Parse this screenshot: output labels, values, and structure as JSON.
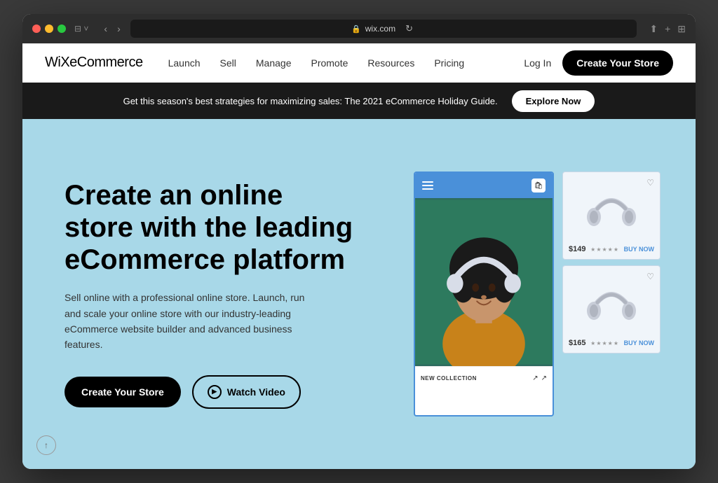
{
  "browser": {
    "address": "wix.com",
    "back_label": "‹",
    "forward_label": "›",
    "refresh_label": "↻",
    "share_label": "⬆",
    "new_tab_label": "+",
    "grid_label": "⊞"
  },
  "navbar": {
    "logo": "WiX",
    "logo_suffix": "eCommerce",
    "links": [
      {
        "label": "Launch"
      },
      {
        "label": "Sell"
      },
      {
        "label": "Manage"
      },
      {
        "label": "Promote"
      },
      {
        "label": "Resources"
      },
      {
        "label": "Pricing"
      }
    ],
    "login_label": "Log In",
    "cta_label": "Create Your Store"
  },
  "banner": {
    "text": "Get this season's best strategies for maximizing sales: The 2021 eCommerce Holiday Guide.",
    "cta_label": "Explore Now"
  },
  "hero": {
    "title": "Create an online store with the leading eCommerce platform",
    "description": "Sell online with a professional online store. Launch, run and scale your online store with our industry-leading eCommerce website builder and advanced business features.",
    "cta_label": "Create Your Store",
    "video_label": "Watch Video",
    "product_card_1": {
      "price": "$149",
      "buy_now": "BUY NOW",
      "stars": "★★★★★"
    },
    "product_card_2": {
      "price": "$165",
      "buy_now": "BUY NOW",
      "stars": "★★★★★"
    },
    "mockup_footer_text": "NEW COLLECTION"
  },
  "footer": {
    "scroll_up_label": "↑"
  },
  "colors": {
    "hero_bg": "#a8d8e8",
    "navbar_bg": "#ffffff",
    "banner_bg": "#1a1a1a",
    "cta_bg": "#000000",
    "accent_blue": "#4a90d9"
  }
}
